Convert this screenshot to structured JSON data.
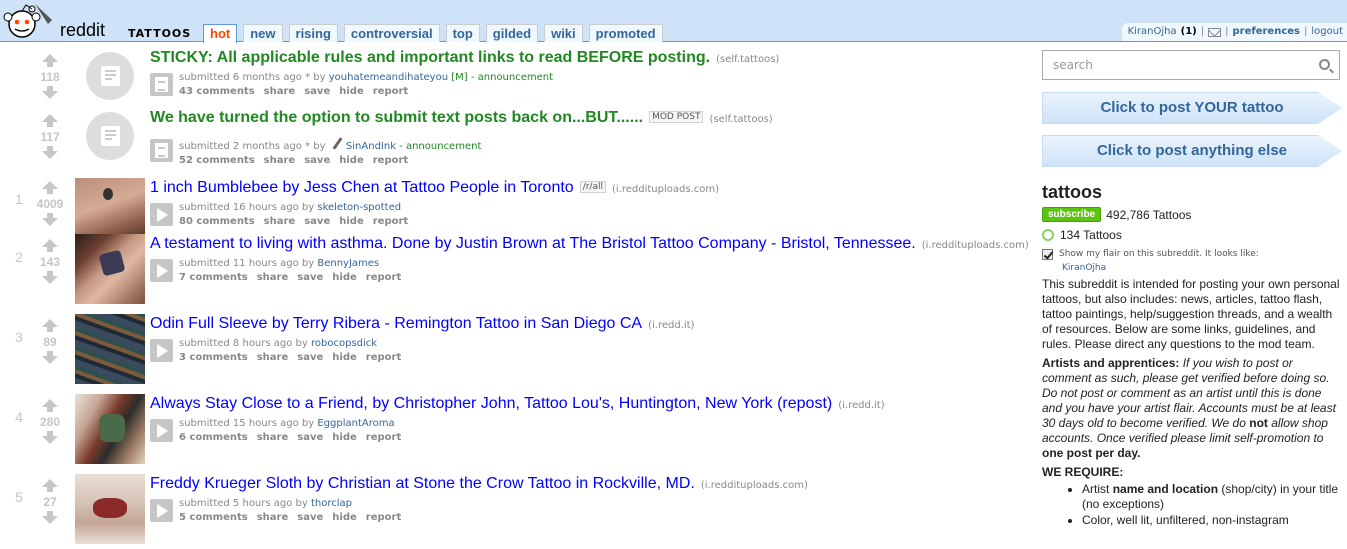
{
  "header": {
    "logo_alt": "reddit",
    "subreddit": "TATTOOS",
    "tabs": [
      {
        "label": "hot",
        "active": true
      },
      {
        "label": "new"
      },
      {
        "label": "rising"
      },
      {
        "label": "controversial"
      },
      {
        "label": "top"
      },
      {
        "label": "gilded"
      },
      {
        "label": "wiki"
      },
      {
        "label": "promoted"
      }
    ],
    "user": {
      "name": "KiranOjha",
      "karma": "(1)",
      "separator": "|",
      "preferences": "preferences",
      "logout": "logout"
    }
  },
  "posts": [
    {
      "rank": "",
      "score": "118",
      "thumb": "self",
      "title": "STICKY: All applicable rules and important links to read BEFORE posting.",
      "flair": "",
      "domain": "(self.tattoos)",
      "submitted": "submitted 6 months ago * by",
      "author": "youhatemeandihateyou",
      "author_suffix": "[M]",
      "distinguish": " - announcement",
      "comments": "43 comments",
      "share": "share",
      "save": "save",
      "hide": "hide",
      "report": "report"
    },
    {
      "rank": "",
      "score": "117",
      "thumb": "self",
      "title": "We have turned the option to submit text posts back on...BUT......",
      "flair": "MOD POST",
      "domain": "(self.tattoos)",
      "submitted": "submitted 2 months ago * by",
      "author": "SinAndInk",
      "author_suffix": "",
      "distinguish": " - announcement",
      "comments": "52 comments",
      "share": "share",
      "save": "save",
      "hide": "hide",
      "report": "report"
    },
    {
      "rank": "1",
      "score": "4009",
      "thumb": "t1",
      "title": "1 inch Bumblebee by Jess Chen at Tattoo People in Toronto",
      "flair": "/r/all",
      "domain": "(i.reddituploads.com)",
      "submitted": "submitted 16 hours ago by",
      "author": "skeleton-spotted",
      "comments": "80 comments",
      "share": "share",
      "save": "save",
      "hide": "hide",
      "report": "report"
    },
    {
      "rank": "2",
      "score": "143",
      "thumb": "t2",
      "title": "A testament to living with asthma. Done by Justin Brown at The Bristol Tattoo Company - Bristol, Tennessee.",
      "flair": "",
      "domain": "(i.reddituploads.com)",
      "submitted": "submitted 11 hours ago by",
      "author": "BennyJames",
      "comments": "7 comments",
      "share": "share",
      "save": "save",
      "hide": "hide",
      "report": "report"
    },
    {
      "rank": "3",
      "score": "89",
      "thumb": "t3",
      "title": "Odin Full Sleeve by Terry Ribera - Remington Tattoo in San Diego CA",
      "flair": "",
      "domain": "(i.redd.it)",
      "submitted": "submitted 8 hours ago by",
      "author": "robocopsdick",
      "comments": "3 comments",
      "share": "share",
      "save": "save",
      "hide": "hide",
      "report": "report"
    },
    {
      "rank": "4",
      "score": "280",
      "thumb": "t4",
      "title": "Always Stay Close to a Friend, by Christopher John, Tattoo Lou's, Huntington, New York (repost)",
      "flair": "",
      "domain": "(i.redd.it)",
      "submitted": "submitted 15 hours ago by",
      "author": "EggplantAroma",
      "comments": "6 comments",
      "share": "share",
      "save": "save",
      "hide": "hide",
      "report": "report"
    },
    {
      "rank": "5",
      "score": "27",
      "thumb": "t5",
      "title": "Freddy Krueger Sloth by Christian at Stone the Crow Tattoo in Rockville, MD.",
      "flair": "",
      "domain": "(i.reddituploads.com)",
      "submitted": "submitted 5 hours ago by",
      "author": "thorclap",
      "comments": "5 comments",
      "share": "share",
      "save": "save",
      "hide": "hide",
      "report": "report"
    }
  ],
  "sidebar": {
    "search_placeholder": "search",
    "post_tattoo": "Click to post YOUR tattoo",
    "post_anything": "Click to post anything else",
    "title": "tattoos",
    "subscribe": "subscribe",
    "subscribers": "492,786 Tattoos",
    "online": "134 Tattoos",
    "flair_text": "Show my flair on this subreddit. It looks like:",
    "flair_user": "KiranOjha",
    "description": "This subreddit is intended for posting your own personal tattoos, but also includes: news, articles, tattoo flash, tattoo paintings, help/suggestion threads, and a wealth of resources. Below are some links, guidelines, and rules. Please direct any questions to the mod team.",
    "artists_heading": "Artists and apprentices:",
    "artists_text_1": "If you wish to post or comment as such, please get verified before doing so. Do not post or comment as an artist until this is done and you have your artist flair. Accounts must be at least 30 days old to become verified. We do",
    "artists_not": "not",
    "artists_text_2": "allow shop accounts. Once verified please limit self-promotion to",
    "artists_limit": "one post per day.",
    "require_heading": "WE REQUIRE:",
    "require_1_a": "Artist",
    "require_1_b": "name and location",
    "require_1_c": "(shop/city) in your title (no exceptions)",
    "require_2": "Color, well lit, unfiltered, non-instagram"
  }
}
